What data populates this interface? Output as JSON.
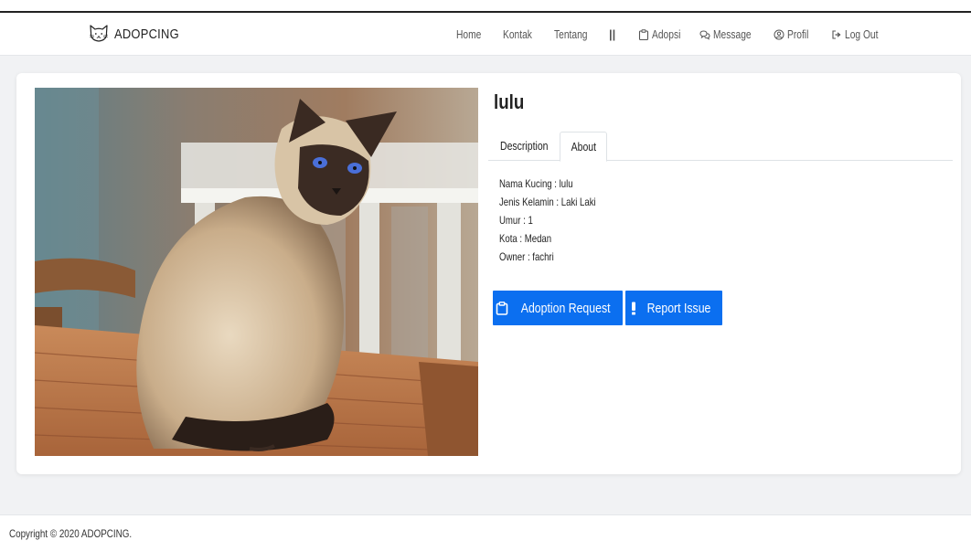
{
  "brand": {
    "name": "ADOPCING",
    "logo_icon": "cat-face-icon"
  },
  "nav": {
    "home": "Home",
    "kontak": "Kontak",
    "tentang": "Tentang",
    "separator": "||",
    "adopsi": "Adopsi",
    "message": "Message",
    "profil": "Profil",
    "logout": "Log Out"
  },
  "pet": {
    "name": "lulu",
    "tabs": {
      "description": "Description",
      "about": "About",
      "active": "About"
    },
    "details": {
      "nama": "Nama Kucing : lulu",
      "jenis": "Jenis Kelamin : Laki Laki",
      "umur": "Umur : 1",
      "kota": "Kota : Medan",
      "owner": "Owner : fachri"
    }
  },
  "actions": {
    "adoption_request": "Adoption Request",
    "report_issue": "Report Issue"
  },
  "footer": {
    "copyright": "Copyright © 2020 ADOPCING."
  },
  "colors": {
    "primary": "#0b6ff0",
    "background": "#f1f2f4"
  }
}
